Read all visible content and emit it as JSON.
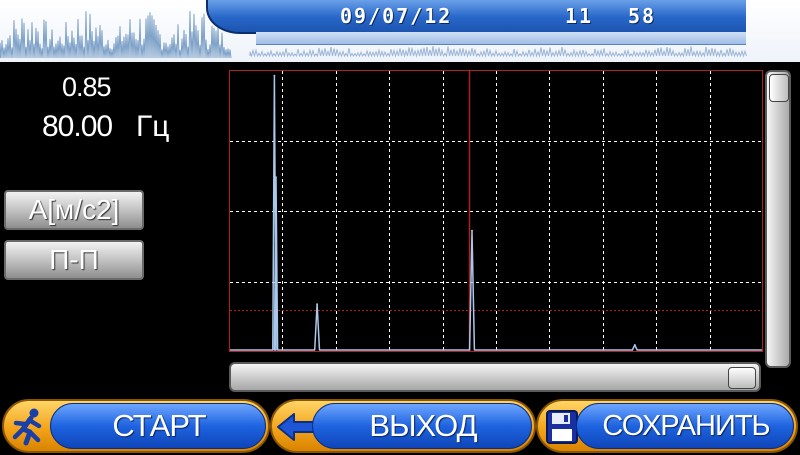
{
  "header": {
    "date": "09/07/12",
    "hour": "11",
    "minute": "58"
  },
  "readout": {
    "value": "0.85",
    "frequency": "80.00",
    "frequency_unit": "Гц"
  },
  "side_buttons": {
    "units_label": "A[м/c2]",
    "mode_label": "П-П"
  },
  "bottom_buttons": {
    "start_label": "СТАРТ",
    "exit_label": "ВЫХОД",
    "save_label": "СОХРАНИТЬ"
  },
  "icons": {
    "start": "runner-icon",
    "exit": "arrow-left-icon",
    "save": "floppy-disk-icon"
  },
  "colors": {
    "background": "#000000",
    "grid": "#ffffff",
    "frame": "#b02020",
    "trace": "#a9c8ec",
    "button_orange": "#f3a41a",
    "button_blue": "#1e63e0",
    "header_blue": "#2766c8"
  },
  "chart_data": {
    "type": "line",
    "grid": true,
    "x_divisions": 10,
    "y_divisions": 4,
    "cursor_x": 0.45,
    "threshold_y": 0.15,
    "xlim": [
      0,
      1
    ],
    "ylim": [
      0,
      1
    ],
    "series": [
      {
        "peaks": [
          {
            "x": 0.085,
            "y": 0.98
          },
          {
            "x": 0.088,
            "y": 0.62
          },
          {
            "x": 0.165,
            "y": 0.17
          },
          {
            "x": 0.455,
            "y": 0.43
          },
          {
            "x": 0.76,
            "y": 0.025
          }
        ]
      }
    ]
  }
}
